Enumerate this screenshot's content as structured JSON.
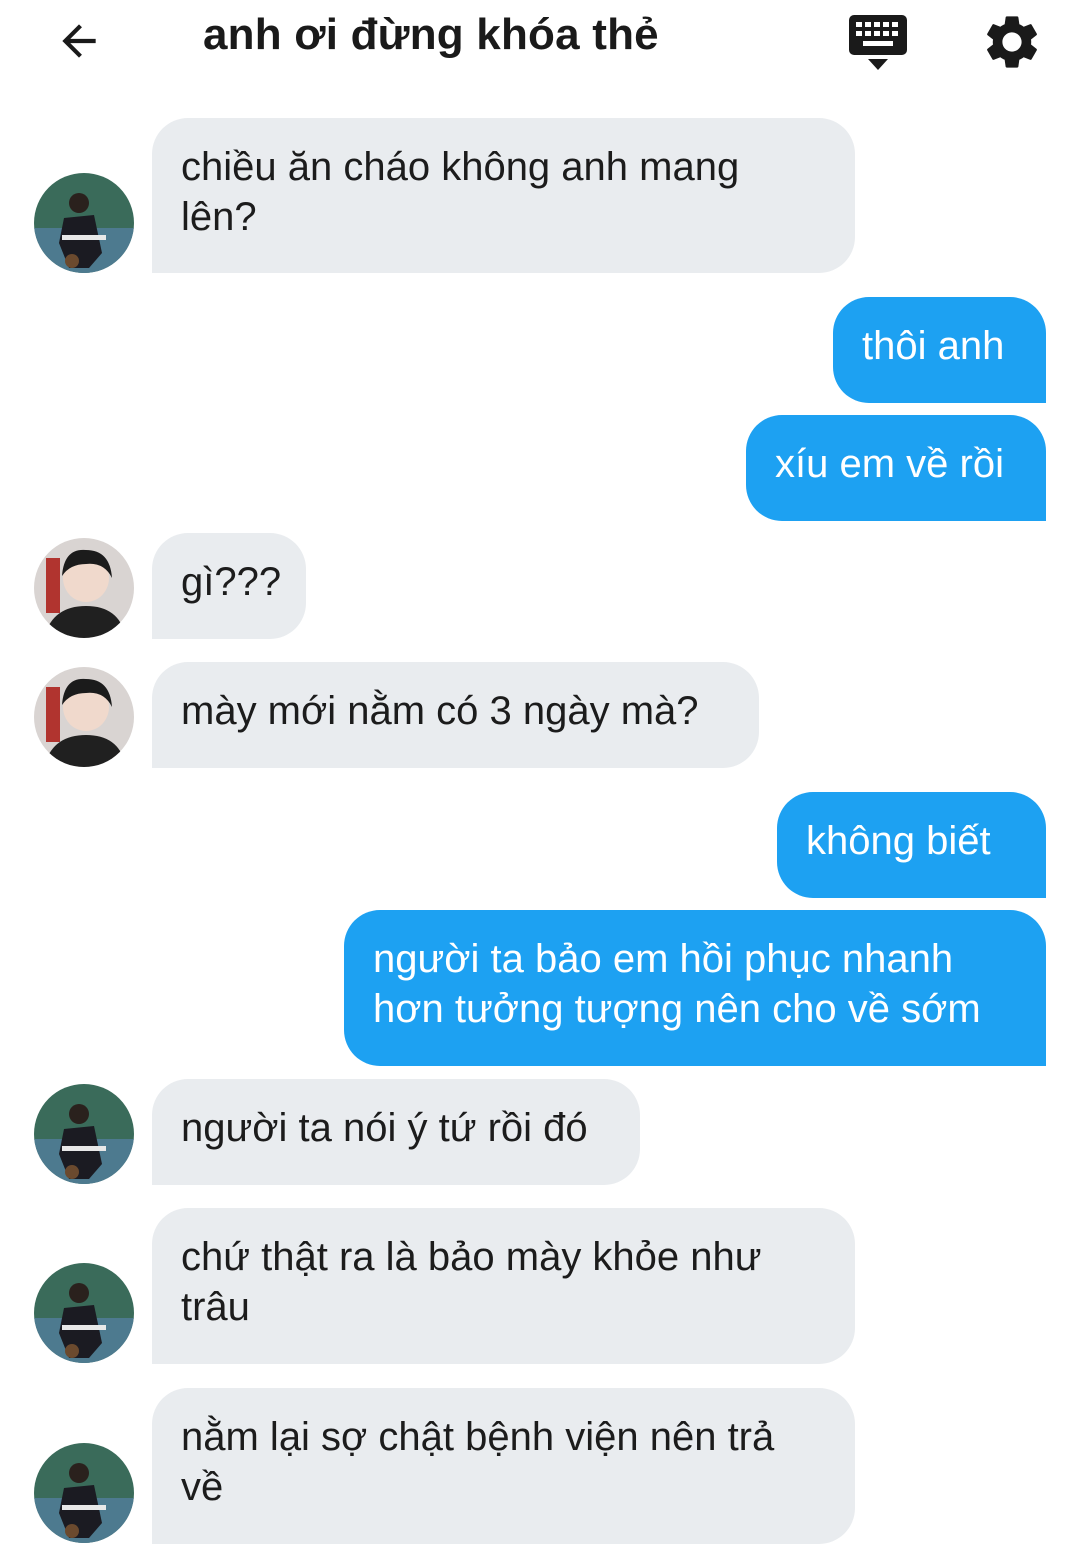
{
  "header": {
    "title": "anh ơi đừng khóa thẻ",
    "back_icon": "arrow-left-icon",
    "keyboard_icon": "keyboard-icon",
    "settings_icon": "gear-icon"
  },
  "colors": {
    "incoming_bubble": "#e9ecef",
    "outgoing_bubble": "#1da1f2",
    "incoming_text": "#1c1c1c",
    "outgoing_text": "#ffffff"
  },
  "messages": [
    {
      "side": "in",
      "line1": "chiều ăn cháo không anh mang",
      "line2": "lên?",
      "avatar": "avatar-a"
    },
    {
      "side": "out",
      "line1": "thôi anh"
    },
    {
      "side": "out",
      "line1": "xíu em về rồi"
    },
    {
      "side": "in",
      "line1": "gì???",
      "avatar": "avatar-b"
    },
    {
      "side": "in",
      "line1": "mày mới nằm có 3 ngày mà?",
      "avatar": "avatar-b"
    },
    {
      "side": "out",
      "line1": "không biết"
    },
    {
      "side": "out",
      "line1": "người ta bảo em hồi phục nhanh",
      "line2": "hơn tưởng tượng nên cho về sớm"
    },
    {
      "side": "in",
      "line1": "người ta nói ý tứ rồi đó",
      "avatar": "avatar-a"
    },
    {
      "side": "in",
      "line1": "chứ thật ra là bảo mày khỏe như",
      "line2": "trâu",
      "avatar": "avatar-a"
    },
    {
      "side": "in",
      "line1": "nằm lại sợ chật bệnh viện nên trả",
      "line2": "về",
      "avatar": "avatar-a"
    }
  ]
}
